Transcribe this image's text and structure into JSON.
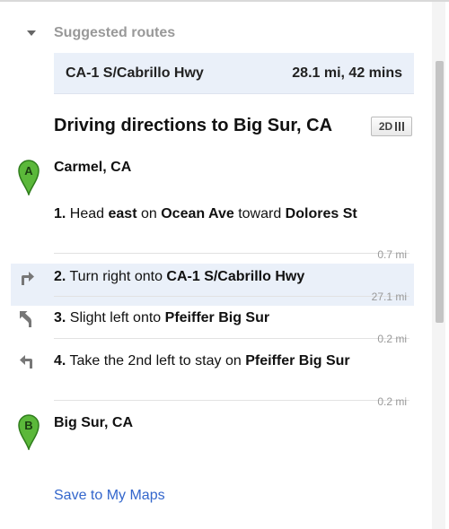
{
  "suggested": {
    "label": "Suggested routes",
    "route_name": "CA-1 S/Cabrillo Hwy",
    "route_summary": "28.1 mi, 42 mins"
  },
  "directions": {
    "title": "Driving directions to Big Sur, CA",
    "view_toggle_label": "2D",
    "start": {
      "marker_letter": "A",
      "place": "Carmel, CA",
      "marker_color": "#5bb83a"
    },
    "end": {
      "marker_letter": "B",
      "place": "Big Sur, CA",
      "marker_color": "#5bb83a"
    },
    "steps": [
      {
        "number": "1.",
        "parts": [
          "Head ",
          "east",
          " on ",
          "Ocean Ave",
          " toward ",
          "Dolores St"
        ],
        "distance": "0.7 mi",
        "icon": "none"
      },
      {
        "number": "2.",
        "parts": [
          "Turn right onto ",
          "CA-1 S/Cabrillo Hwy"
        ],
        "distance": "27.1 mi",
        "icon": "turn-right-icon"
      },
      {
        "number": "3.",
        "parts": [
          "Slight left onto ",
          "Pfeiffer Big Sur"
        ],
        "distance": "0.2 mi",
        "icon": "slight-left-icon"
      },
      {
        "number": "4.",
        "parts": [
          "Take the 2nd left to stay on ",
          "Pfeiffer Big Sur"
        ],
        "distance": "0.2 mi",
        "icon": "turn-left-icon"
      }
    ]
  },
  "save_link": "Save to My Maps",
  "colors": {
    "highlight": "#eaf0f9",
    "link": "#3366cc",
    "muted": "#999999",
    "marker": "#5bb83a"
  }
}
